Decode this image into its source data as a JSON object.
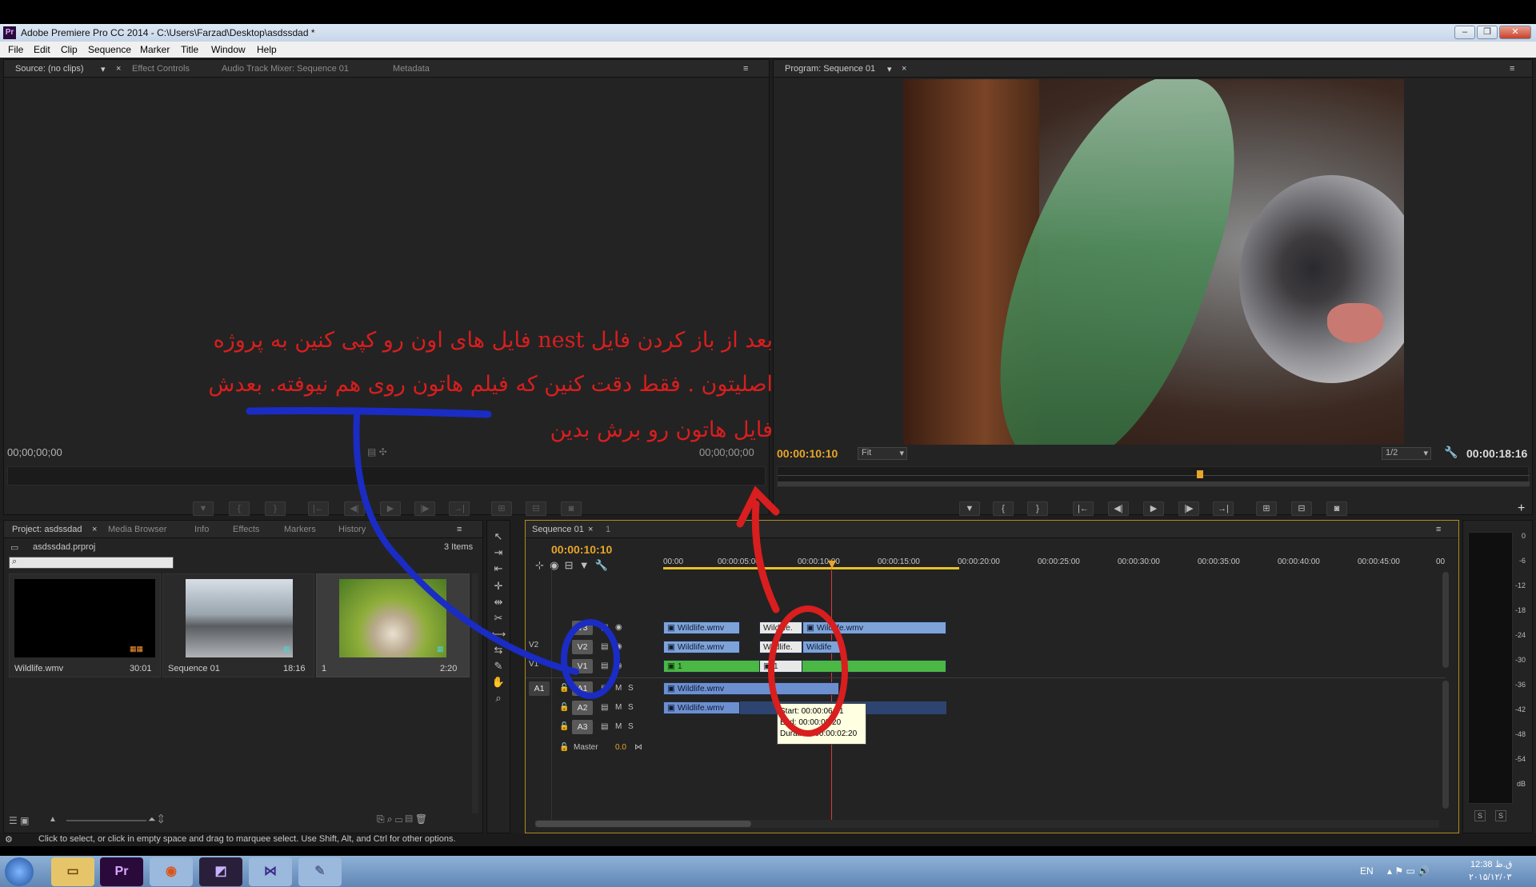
{
  "titlebar": {
    "app_title": "Adobe Premiere Pro CC 2014 - C:\\Users\\Farzad\\Desktop\\asdssdad *",
    "icon": "Pr"
  },
  "menu": [
    "File",
    "Edit",
    "Clip",
    "Sequence",
    "Marker",
    "Title",
    "Window",
    "Help"
  ],
  "source_panel": {
    "tabs": [
      "Source: (no clips)",
      "Effect Controls",
      "Audio Track Mixer: Sequence 01",
      "Metadata"
    ],
    "timecode_left": "00;00;00;00",
    "timecode_right": "00;00;00;00"
  },
  "program_panel": {
    "tab": "Program: Sequence 01",
    "timecode": "00:00:10:10",
    "fit": "Fit",
    "resolution": "1/2",
    "duration": "00:00:18:16"
  },
  "project_panel": {
    "tabs": [
      "Project: asdssdad",
      "Media Browser",
      "Info",
      "Effects",
      "Markers",
      "History"
    ],
    "filename": "asdssdad.prproj",
    "items_count": "3 Items",
    "items": [
      {
        "name": "Wildlife.wmv",
        "duration": "30:01"
      },
      {
        "name": "Sequence 01",
        "duration": "18:16"
      },
      {
        "name": "1",
        "duration": "2:20"
      }
    ]
  },
  "timeline": {
    "tabs": [
      "Sequence 01",
      "1"
    ],
    "timecode": "00:00:10:10",
    "ruler": [
      "00:00",
      "00:00:05:00",
      "00:00:10:00",
      "00:00:15:00",
      "00:00:20:00",
      "00:00:25:00",
      "00:00:30:00",
      "00:00:35:00",
      "00:00:40:00",
      "00:00:45:00",
      "00"
    ],
    "video_tracks": [
      "V3",
      "V2",
      "V1"
    ],
    "audio_tracks": [
      "A1",
      "A2",
      "A3"
    ],
    "source_patch_v": [
      "V2",
      "V1"
    ],
    "source_patch_a": "A1",
    "master_label": "Master",
    "master_value": "0.0",
    "track_m": "M",
    "track_s": "S",
    "clip_wildlife": "Wildlife.wmv",
    "clip_wildlife_short": "Wildlife.",
    "clip_wildlife_mid": "Wildlife.wmv",
    "clip_wildlife_cut": "Wildife",
    "clip_one": "1",
    "tooltip": {
      "start": "Start: 00:00:06:01",
      "end": "End: 00:00:08:20",
      "duration": "Duration: 00:00:02:20"
    }
  },
  "audio_meter": {
    "labels": [
      "0",
      "-6",
      "-12",
      "-18",
      "-24",
      "-30",
      "-36",
      "-42",
      "-48",
      "-54",
      "dB"
    ],
    "solo": "S"
  },
  "status_bar": "Click to select, or click in empty space and drag to marquee select. Use Shift, Alt, and Ctrl for other options.",
  "annotation": {
    "line1": "بعد از باز کردن فایل nest فایل های اون رو کپی کنین به پروژه",
    "line2": "اصلیتون . فقط دقت کنین که فیلم هاتون روی هم نیوفته. بعدش",
    "line3": "فایل هاتون رو برش بدین"
  },
  "taskbar": {
    "lang": "EN",
    "time": "12:38 ق.ظ",
    "date": "۲۰۱۵/۱۲/۰۳",
    "app_premiere": "Pr"
  },
  "colors": {
    "accent_orange": "#e8a52a",
    "annotation_red": "#d81e1e",
    "annotation_blue": "#1a2cc4",
    "clip_blue": "#7ea3d9",
    "clip_green": "#4bb745"
  }
}
